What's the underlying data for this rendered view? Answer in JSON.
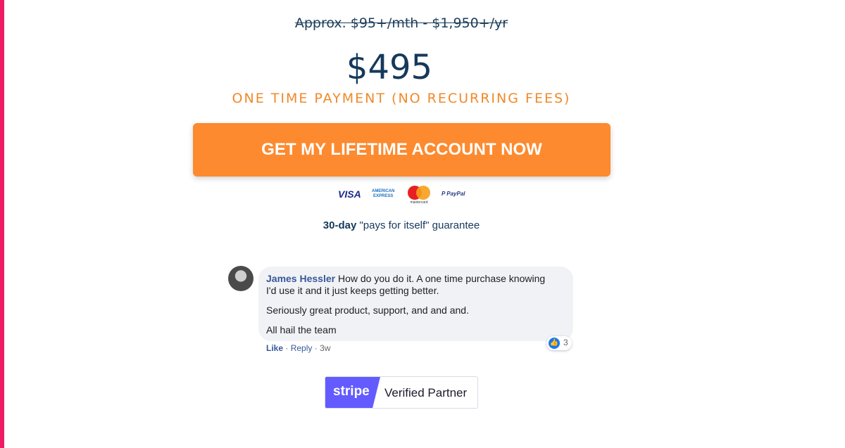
{
  "pricing": {
    "old_price": "Approx. $95+/mth - $1,950+/yr",
    "price": "$495",
    "note": "ONE TIME PAYMENT (NO RECURRING FEES)"
  },
  "cta": {
    "label": "GET MY LIFETIME ACCOUNT NOW"
  },
  "payment_logos": {
    "visa": "VISA",
    "amex": "AMERICAN EXPRESS",
    "mastercard": "mastercard",
    "paypal": "PayPal"
  },
  "guarantee": {
    "bold": "30-day",
    "rest": " \"pays for itself\" guarantee"
  },
  "comment": {
    "author": "James Hessler",
    "line1": " How do you do it. A one time purchase knowing",
    "line2": "I'd use it and it just keeps getting better.",
    "line3": "Seriously great product, support, and and and.",
    "line4": "All hail the team",
    "like": "Like",
    "reply": "Reply",
    "time": "3w",
    "reactions": "3"
  },
  "badge": {
    "brand": "stripe",
    "text": "Verified Partner"
  },
  "colors": {
    "accent": "#fd8a2e",
    "navy": "#15395b",
    "stripe": "#635bff",
    "edge": "#ee1a63"
  }
}
